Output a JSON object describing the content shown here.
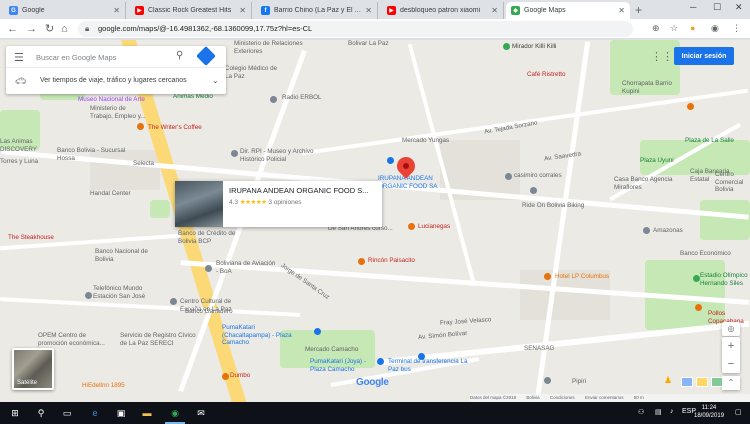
{
  "browser": {
    "tabs": [
      {
        "title": "Google",
        "icon": "google-icon",
        "color": "#4285f4"
      },
      {
        "title": "Classic Rock Greatest Hits",
        "icon": "youtube-icon",
        "color": "#ff0000"
      },
      {
        "title": "Barrio Chino (La Paz y El Alto)",
        "icon": "facebook-icon",
        "color": "#1877f2"
      },
      {
        "title": "desbloqueo patron xiaomi",
        "icon": "youtube-icon",
        "color": "#ff0000"
      },
      {
        "title": "Google Maps",
        "icon": "maps-icon",
        "color": "#34a853"
      }
    ],
    "active_tab": 4,
    "url": "google.com/maps/@-16.4981362,-68.1360099,17.75z?hl=es-CL",
    "new_tab": "+"
  },
  "maps": {
    "search_placeholder": "Buscar en Google Maps",
    "directions_hint": "Ver tiempos de viaje, tráfico y lugares cercanos",
    "sign_in": "Iniciar sesión",
    "place": {
      "name": "IRUPANA ANDEAN ORGANIC FOOD S...",
      "rating": "4.3",
      "stars": "★★★★★",
      "reviews": "3 opiniones"
    },
    "satellite_label": "Satélite",
    "google_logo": "Google",
    "footer": [
      "Datos del mapa ©2019",
      "Bolivia",
      "Condiciones",
      "Enviar comentarios",
      "50 m"
    ],
    "labels": [
      {
        "text": "Bolivar La Paz",
        "color": "#5f6368"
      },
      {
        "text": "Mirador Killi Killi",
        "color": "#3c4043"
      },
      {
        "text": "Café Ristretto",
        "color": "#c5221f"
      },
      {
        "text": "Ministerio de Relaciones Exteriores",
        "color": "#5f6368"
      },
      {
        "text": "Colegio Médico de La Paz",
        "color": "#5f6368"
      },
      {
        "text": "Radio ERBOL",
        "color": "#5f6368"
      },
      {
        "text": "Animas Medio",
        "color": "#188038"
      },
      {
        "text": "Museo Nacional de Arte",
        "color": "#a142f4"
      },
      {
        "text": "Ministerio de Trabajo, Empleo y...",
        "color": "#5f6368"
      },
      {
        "text": "The Writer's Coffee",
        "color": "#c5221f"
      },
      {
        "text": "Mercado Yungas",
        "color": "#5f6368"
      },
      {
        "text": "Av. Tejada Sorzano",
        "color": "#5f6368"
      },
      {
        "text": "Chorrapata Barrio Kupini",
        "color": "#5f6368"
      },
      {
        "text": "Plaza de La Salle",
        "color": "#188038"
      },
      {
        "text": "Las Animas DISCOVERY",
        "color": "#5f6368"
      },
      {
        "text": "Banco Bolivia - Sucursal Hossa",
        "color": "#5f6368"
      },
      {
        "text": "Selecta",
        "color": "#5f6368"
      },
      {
        "text": "Dir. RPI - Museo y Archivo Histórico Policial",
        "color": "#5f6368"
      },
      {
        "text": "IRUPANA ANDEAN ORGANIC FOOD SA",
        "color": "#1a73e8"
      },
      {
        "text": "Av. Saavedra",
        "color": "#5f6368"
      },
      {
        "text": "Plaza Uyuni",
        "color": "#188038"
      },
      {
        "text": "Casa Banco Agencia Miraflores",
        "color": "#5f6368"
      },
      {
        "text": "Centro Comercial Bolivia",
        "color": "#5f6368"
      },
      {
        "text": "Caja Bancaria Estatal",
        "color": "#5f6368"
      },
      {
        "text": "casimiro corrales",
        "color": "#5f6368"
      },
      {
        "text": "Ride On Bolivia Biking",
        "color": "#5f6368"
      },
      {
        "text": "Handal Center",
        "color": "#5f6368"
      },
      {
        "text": "The Steakhouse",
        "color": "#c5221f"
      },
      {
        "text": "Banco de Crédito de Bolivia BCP",
        "color": "#5f6368"
      },
      {
        "text": "Lucianegas",
        "color": "#c5221f"
      },
      {
        "text": "Rincón Paisacito",
        "color": "#c5221f"
      },
      {
        "text": "De San Andrés curso...",
        "color": "#5f6368"
      },
      {
        "text": "Amazonas",
        "color": "#5f6368"
      },
      {
        "text": "Banco Económico",
        "color": "#5f6368"
      },
      {
        "text": "Banco Nacional de Bolivia",
        "color": "#5f6368"
      },
      {
        "text": "Boliviana de Aviación - BoA",
        "color": "#5f6368"
      },
      {
        "text": "Hotel LP Columbus",
        "color": "#e8710a"
      },
      {
        "text": "Estadio Olímpico Hernando Siles",
        "color": "#188038"
      },
      {
        "text": "Telefónico Mundo Estación San José",
        "color": "#5f6368"
      },
      {
        "text": "Banco Ganadero",
        "color": "#5f6368"
      },
      {
        "text": "Centro Cultural de España en La Paz",
        "color": "#5f6368"
      },
      {
        "text": "Pollos Copacabana",
        "color": "#c5221f"
      },
      {
        "text": "OPEM Centro de promoción económica...",
        "color": "#5f6368"
      },
      {
        "text": "Servicio de Registro Cívico de La Paz SERECI",
        "color": "#5f6368"
      },
      {
        "text": "PumaKatari (Chacaltapampa) - Plaza Camacho",
        "color": "#1a73e8"
      },
      {
        "text": "Av. Simón Bolívar",
        "color": "#5f6368"
      },
      {
        "text": "Mercado Camacho",
        "color": "#5f6368"
      },
      {
        "text": "PumaKatari (Joya) - Plaza Camacho",
        "color": "#1a73e8"
      },
      {
        "text": "Terminal de transferencia La Paz bus",
        "color": "#1a73e8"
      },
      {
        "text": "SENASAG",
        "color": "#5f6368"
      },
      {
        "text": "Dumbo",
        "color": "#c5221f"
      },
      {
        "text": "Pipiri",
        "color": "#5f6368"
      },
      {
        "text": "HiEdellnn 1895",
        "color": "#e8710a"
      },
      {
        "text": "Fray José Velasco",
        "color": "#5f6368"
      },
      {
        "text": "Jorge de Santa Cruz",
        "color": "#5f6368"
      },
      {
        "text": "Torres y Luna",
        "color": "#5f6368"
      }
    ]
  },
  "taskbar": {
    "time": "11:24",
    "date": "18/09/2019",
    "lang": "ESP"
  }
}
